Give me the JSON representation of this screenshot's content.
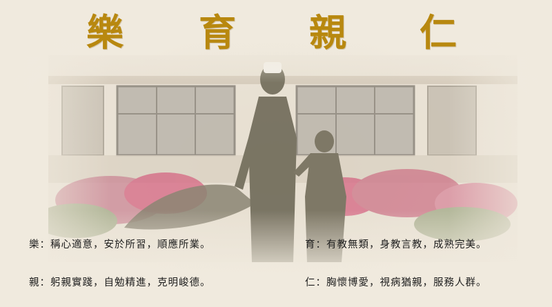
{
  "title": {
    "chars": [
      "樂",
      "育",
      "親",
      "仁"
    ]
  },
  "mottos": [
    "樂：稱心適意，安於所習，順應所業。",
    "育：有教無類，身教言教，成熟完美。",
    "親：躬親實踐，自勉精進，克明峻德。",
    "仁：胸懷博愛，視病猶親，服務人群。"
  ],
  "colors": {
    "title": "#b8880f",
    "text": "#1e1e1e",
    "paper": "#efe9dd",
    "statue": "#6f6a58",
    "flowers": "#d2587a"
  }
}
